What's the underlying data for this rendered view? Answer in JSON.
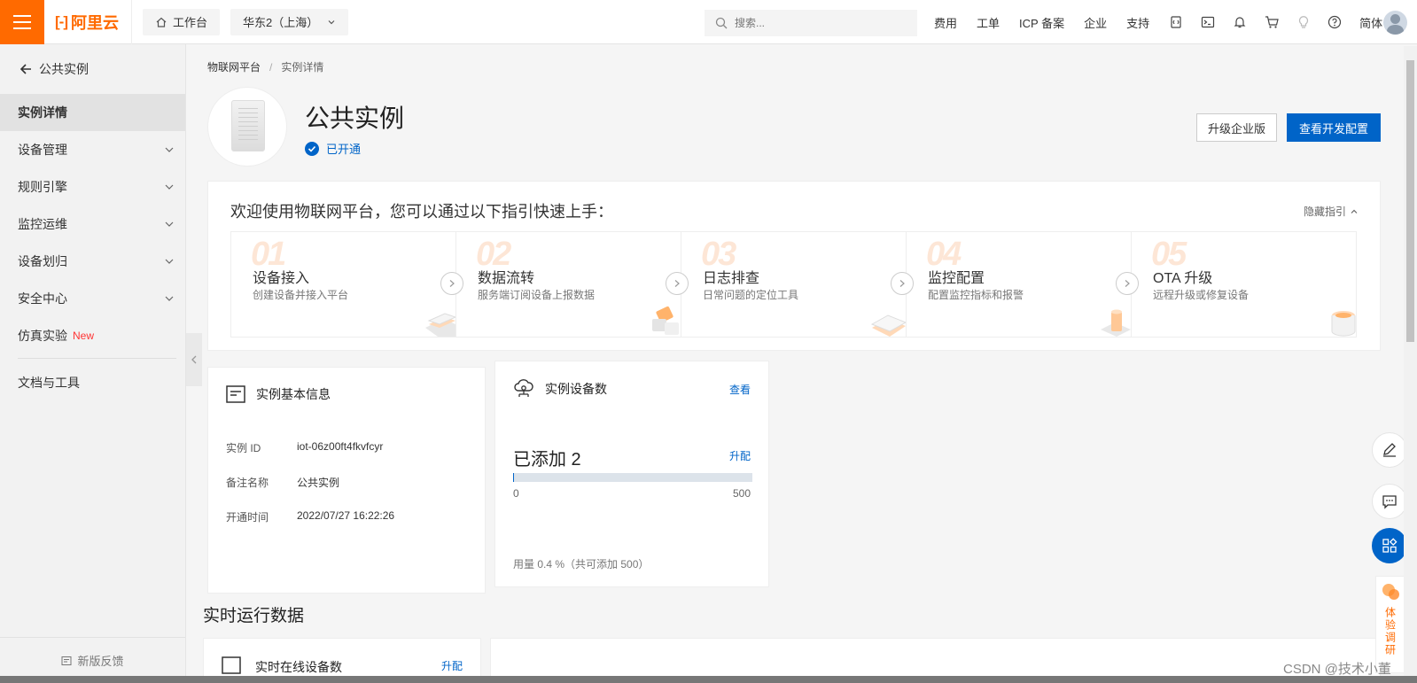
{
  "topbar": {
    "brand": "阿里云",
    "workbench": "工作台",
    "region": "华东2（上海）",
    "search_placeholder": "搜索...",
    "nav": [
      "费用",
      "工单",
      "ICP 备案",
      "企业",
      "支持"
    ],
    "lang": "简体"
  },
  "sidebar": {
    "back_label": "公共实例",
    "items": [
      {
        "label": "实例详情",
        "active": true
      },
      {
        "label": "设备管理"
      },
      {
        "label": "规则引擎"
      },
      {
        "label": "监控运维"
      },
      {
        "label": "设备划归"
      },
      {
        "label": "安全中心"
      },
      {
        "label": "仿真实验",
        "badge": "New"
      },
      {
        "label": "文档与工具"
      }
    ],
    "feedback": "新版反馈"
  },
  "breadcrumb": {
    "root": "物联网平台",
    "sep": "/",
    "current": "实例详情"
  },
  "instance": {
    "title": "公共实例",
    "status": "已开通",
    "upgrade_label": "升级企业版",
    "devconfig_label": "查看开发配置"
  },
  "guide": {
    "title": "欢迎使用物联网平台，您可以通过以下指引快速上手：",
    "hide_label": "隐藏指引",
    "steps": [
      {
        "num": "01",
        "title": "设备接入",
        "desc": "创建设备并接入平台"
      },
      {
        "num": "02",
        "title": "数据流转",
        "desc": "服务端订阅设备上报数据"
      },
      {
        "num": "03",
        "title": "日志排查",
        "desc": "日常问题的定位工具"
      },
      {
        "num": "04",
        "title": "监控配置",
        "desc": "配置监控指标和报警"
      },
      {
        "num": "05",
        "title": "OTA 升级",
        "desc": "远程升级或修复设备"
      }
    ]
  },
  "basic_info": {
    "title": "实例基本信息",
    "rows": [
      {
        "key": "实例 ID",
        "value": "iot-06z00ft4fkvfcyr"
      },
      {
        "key": "备注名称",
        "value": "公共实例"
      },
      {
        "key": "开通时间",
        "value": "2022/07/27 16:22:26"
      }
    ]
  },
  "devices": {
    "title": "实例设备数",
    "view_label": "查看",
    "added_label": "已添加 2",
    "upgrade_label": "升配",
    "min": "0",
    "max": "500",
    "used_fraction": 0.004,
    "usage_text": "用量 0.4 %（共可添加 500）"
  },
  "realtime": {
    "title": "实时运行数据",
    "online_card_title": "实时在线设备数",
    "online_card_link": "升配"
  },
  "float": {
    "survey_label": "体验调研"
  },
  "watermark": "CSDN @技术小董"
}
